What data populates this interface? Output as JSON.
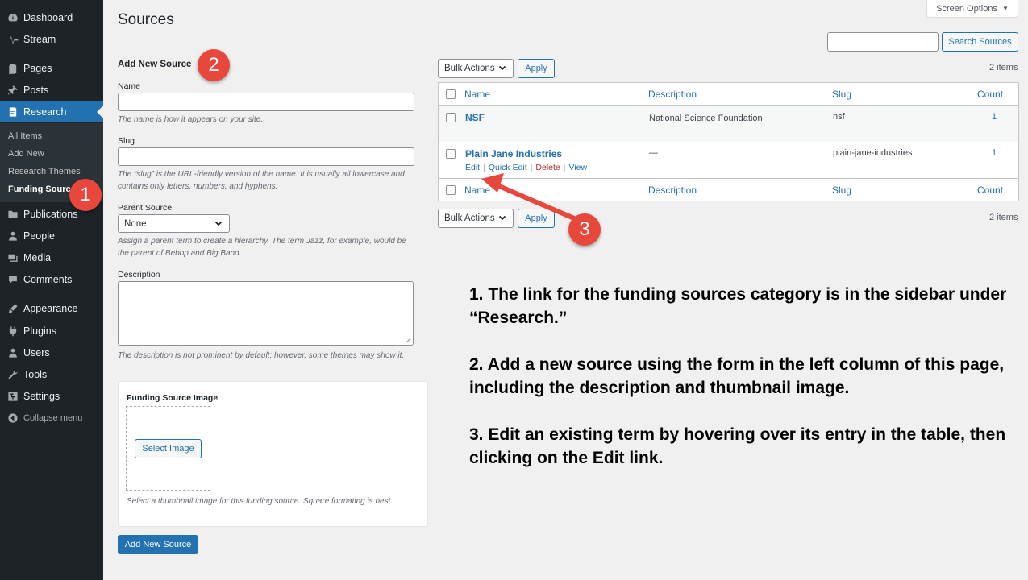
{
  "sidebar": {
    "items": [
      {
        "label": "Dashboard",
        "icon": "dashboard-icon"
      },
      {
        "label": "Stream",
        "icon": "stream-icon"
      },
      {
        "label": "Pages",
        "icon": "pages-icon"
      },
      {
        "label": "Posts",
        "icon": "posts-icon"
      },
      {
        "label": "Research",
        "icon": "research-icon",
        "current": true
      },
      {
        "label": "Publications",
        "icon": "publications-icon"
      },
      {
        "label": "People",
        "icon": "people-icon"
      },
      {
        "label": "Media",
        "icon": "media-icon"
      },
      {
        "label": "Comments",
        "icon": "comments-icon"
      },
      {
        "label": "Appearance",
        "icon": "appearance-icon"
      },
      {
        "label": "Plugins",
        "icon": "plugins-icon"
      },
      {
        "label": "Users",
        "icon": "users-icon"
      },
      {
        "label": "Tools",
        "icon": "tools-icon"
      },
      {
        "label": "Settings",
        "icon": "settings-icon"
      }
    ],
    "submenu": [
      "All Items",
      "Add New",
      "Research Themes",
      "Funding Sources"
    ],
    "collapse_label": "Collapse menu"
  },
  "header": {
    "title": "Sources",
    "screen_options": "Screen Options"
  },
  "search": {
    "button": "Search Sources",
    "value": ""
  },
  "form": {
    "heading": "Add New Source",
    "name_label": "Name",
    "name_help": "The name is how it appears on your site.",
    "slug_label": "Slug",
    "slug_help": "The “slug” is the URL-friendly version of the name. It is usually all lowercase and contains only letters, numbers, and hyphens.",
    "parent_label": "Parent Source",
    "parent_value": "None",
    "parent_help": "Assign a parent term to create a hierarchy. The term Jazz, for example, would be the parent of Bebop and Big Band.",
    "description_label": "Description",
    "description_help": "The description is not prominent by default; however, some themes may show it.",
    "image_title": "Funding Source Image",
    "image_button": "Select Image",
    "image_help": "Select a thumbnail image for this funding source. Square formating is best.",
    "submit": "Add New Source"
  },
  "tablenav": {
    "bulk_actions": "Bulk Actions",
    "apply": "Apply",
    "count": "2 items"
  },
  "table": {
    "columns": [
      "Name",
      "Description",
      "Slug",
      "Count"
    ],
    "rows": [
      {
        "name": "NSF",
        "description": "National Science Foundation",
        "slug": "nsf",
        "count": "1"
      },
      {
        "name": "Plain Jane Industries",
        "description": "—",
        "slug": "plain-jane-industries",
        "count": "1"
      }
    ],
    "row_actions": [
      "Edit",
      "Quick Edit",
      "Delete",
      "View"
    ]
  },
  "annotations": {
    "badges": [
      "1",
      "2",
      "3"
    ],
    "badge_color": "#e8473b",
    "instructions": [
      "1. The link for the funding sources category is in the sidebar under “Research.”",
      "2. Add a new source using the form in the left column of this page, including the description and thumbnail image.",
      "3. Edit an existing term by hovering over its entry in the table, then clicking on the Edit link."
    ]
  },
  "colors": {
    "sidebar_bg": "#1d2327",
    "accent": "#2271b1",
    "delete": "#b32d2e"
  }
}
